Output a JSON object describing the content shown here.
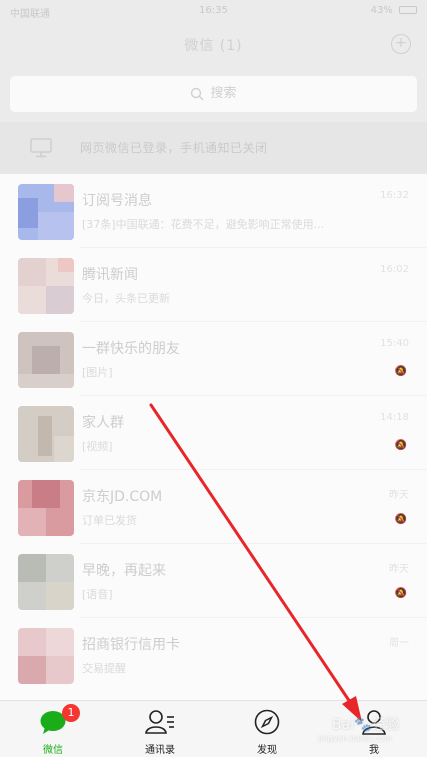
{
  "status_bar": {
    "carrier": "中国联通",
    "time": "16:35",
    "battery": "43%"
  },
  "header": {
    "title": "微信 (1)"
  },
  "search": {
    "placeholder": "搜索"
  },
  "device_banner": {
    "text": "网页微信已登录，手机通知已关闭"
  },
  "chats": [
    {
      "name": "订阅号消息",
      "preview": "[37条]中国联通：花费不足，避免影响正常使用...",
      "time": "16:32",
      "mute": ""
    },
    {
      "name": "腾讯新闻",
      "preview": "今日，头条已更新",
      "time": "16:02",
      "mute": ""
    },
    {
      "name": "一群快乐的朋友",
      "preview": "[图片]",
      "time": "15:40",
      "mute": "🔕"
    },
    {
      "name": "家人群",
      "preview": "[视频]",
      "time": "14:18",
      "mute": "🔕"
    },
    {
      "name": "京东JD.COM",
      "preview": "订单已发货",
      "time": "昨天",
      "mute": "🔕"
    },
    {
      "name": "早晚，再起来",
      "preview": "[语音]",
      "time": "昨天",
      "mute": "🔕"
    },
    {
      "name": "招商银行信用卡",
      "preview": "交易提醒",
      "time": "周一",
      "mute": ""
    }
  ],
  "tabs": [
    {
      "label": "微信",
      "badge": "1"
    },
    {
      "label": "通讯录"
    },
    {
      "label": "发现"
    },
    {
      "label": "我"
    }
  ],
  "watermark": {
    "text": "Bai🐾经验",
    "sub": "jingyan.baidu.com"
  },
  "colors": {
    "accent": "#1aad19",
    "badge": "#f43530",
    "arrow": "#e8262a"
  }
}
